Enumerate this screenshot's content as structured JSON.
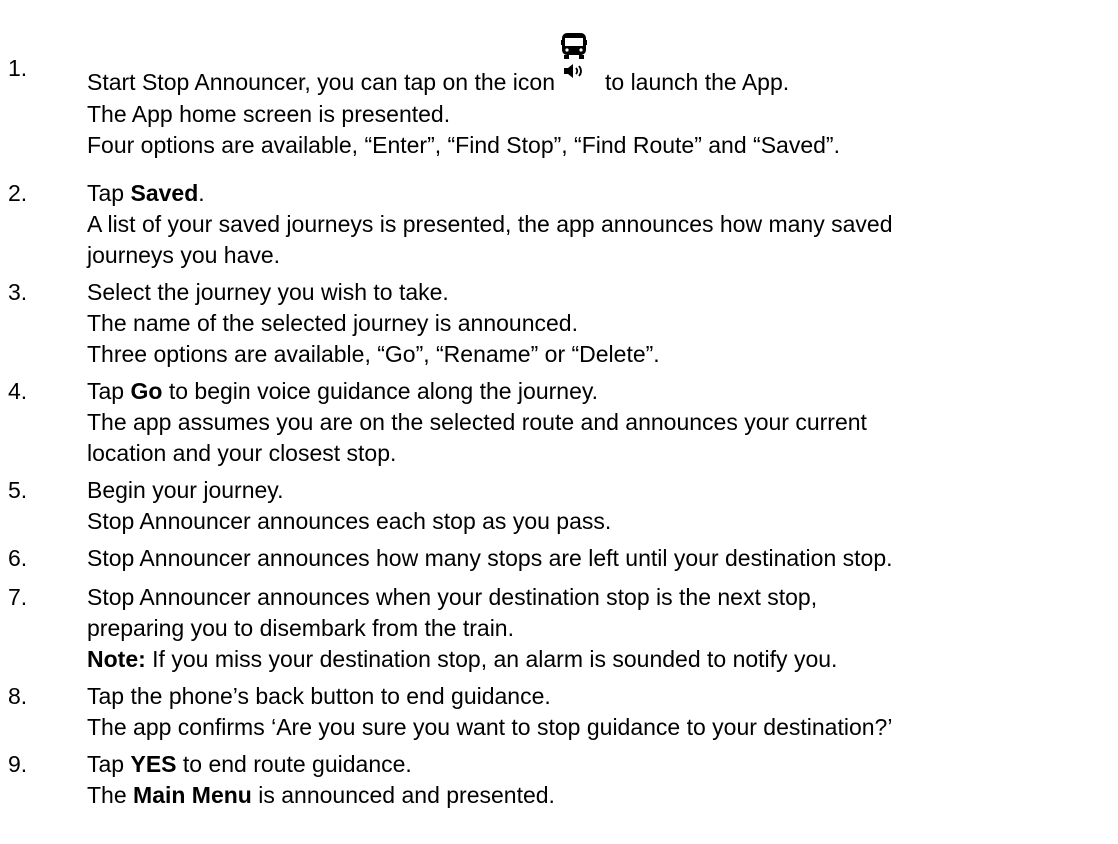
{
  "steps": [
    {
      "number": "1.",
      "lines": [
        {
          "a": "Start Stop Announcer, you can tap on the icon",
          "icon": "bus-speaker-icon",
          "b": "to launch the App."
        },
        {
          "t": "The App home screen is presented."
        },
        {
          "t": "Four options are available, “Enter”, “Find Stop”, “Find Route” and “Saved”."
        }
      ]
    },
    {
      "number": "2.",
      "lines": [
        {
          "pre": "Tap ",
          "bold": "Saved",
          "post": "."
        },
        {
          "t": "A list of your saved journeys is presented, the app announces how many saved"
        },
        {
          "t": "journeys you have."
        }
      ]
    },
    {
      "number": "3.",
      "lines": [
        {
          "t": "Select the journey you wish to take."
        },
        {
          "t": "The name of the selected journey is announced."
        },
        {
          "t": "Three options are available, “Go”, “Rename” or “Delete”."
        }
      ]
    },
    {
      "number": "4.",
      "lines": [
        {
          "pre": "Tap ",
          "bold": "Go",
          "post": " to begin voice guidance along the journey."
        },
        {
          "t": "The app assumes you are on the selected route and announces your current"
        },
        {
          "t": "location and your closest stop."
        }
      ]
    },
    {
      "number": "5.",
      "lines": [
        {
          "t": "Begin your journey."
        },
        {
          "t": "Stop Announcer announces each stop as you pass."
        }
      ]
    },
    {
      "number": "6.",
      "lines": [
        {
          "t": "Stop Announcer announces how many stops are left until your destination stop."
        }
      ]
    },
    {
      "number": "7.",
      "lines": [
        {
          "t": "Stop Announcer announces when your destination stop is the next stop,"
        },
        {
          "t": "preparing you to disembark from the train."
        },
        {
          "pre": "",
          "bold": "Note:",
          "post": " If you miss your destination stop, an alarm is sounded to notify you."
        }
      ]
    },
    {
      "number": "8.",
      "lines": [
        {
          "t": "Tap the phone’s back button to end guidance."
        },
        {
          "t": "The app confirms ‘Are you sure you want to stop guidance to your destination?’"
        }
      ]
    },
    {
      "number": "9.",
      "lines": [
        {
          "pre": "Tap ",
          "bold": "YES",
          "post": " to end route guidance."
        },
        {
          "pre": "The ",
          "bold": "Main Menu",
          "post": " is announced and presented."
        }
      ]
    }
  ]
}
